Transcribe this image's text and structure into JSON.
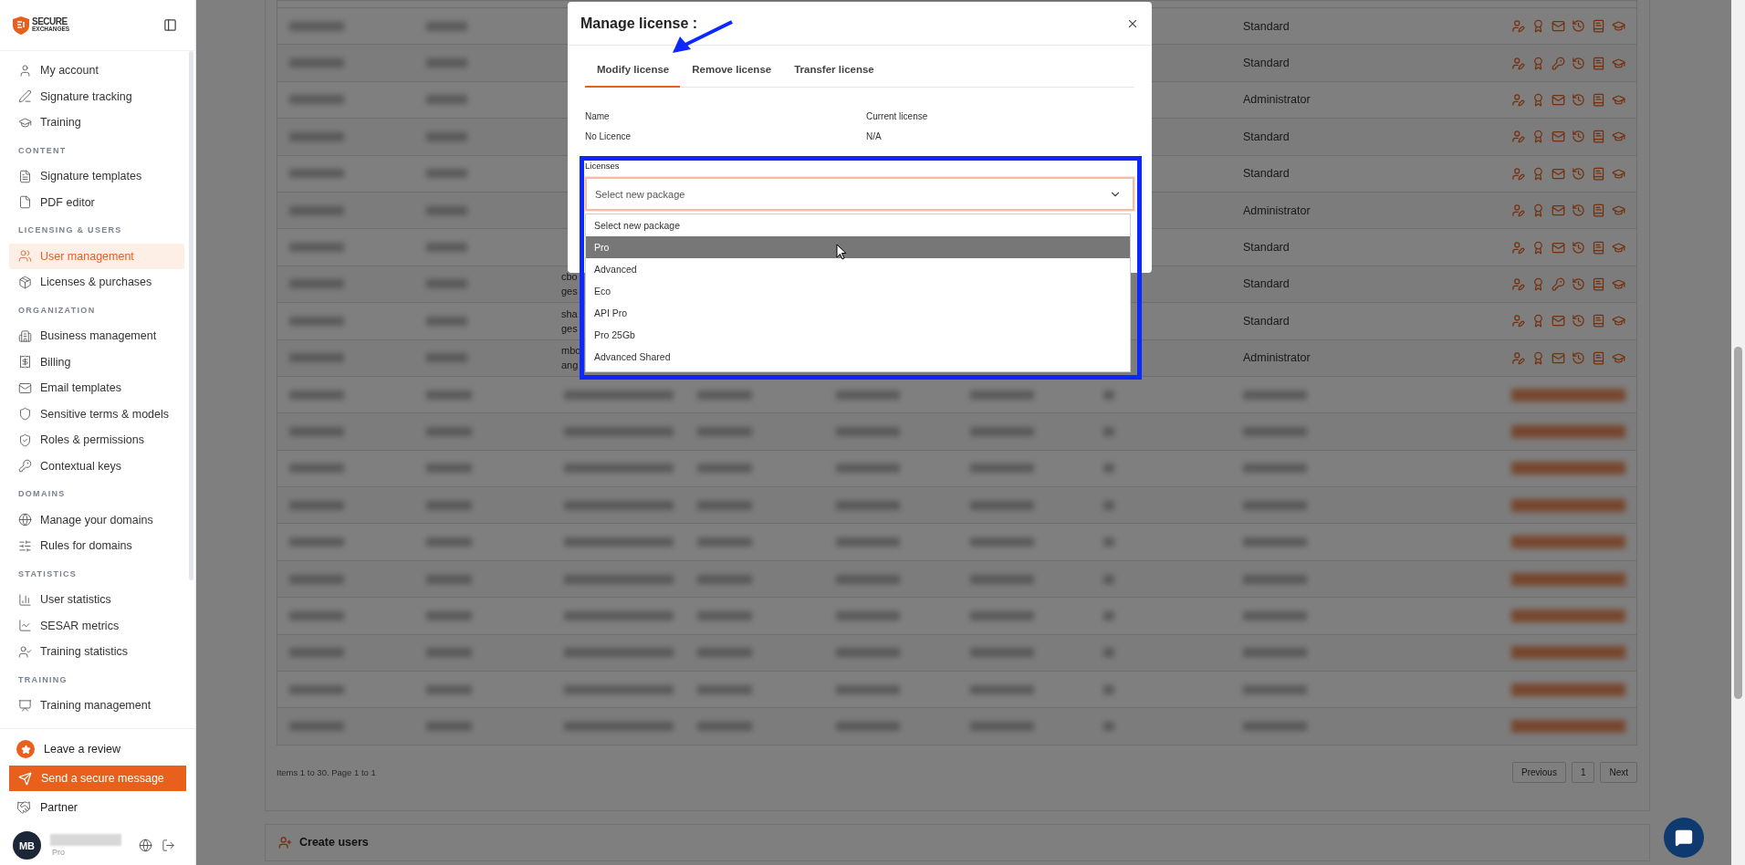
{
  "sidebar": {
    "logo_text": "SECURE",
    "logo_subtext": "EXCHANGES",
    "sections": [
      {
        "items": [
          {
            "label": "My account",
            "selected": false
          },
          {
            "label": "Signature tracking",
            "selected": false
          },
          {
            "label": "Training",
            "selected": false
          }
        ]
      },
      {
        "title": "CONTENT",
        "items": [
          {
            "label": "Signature templates",
            "selected": false
          },
          {
            "label": "PDF editor",
            "selected": false
          }
        ]
      },
      {
        "title": "LICENSING & USERS",
        "items": [
          {
            "label": "User management",
            "selected": true
          },
          {
            "label": "Licenses & purchases",
            "selected": false
          }
        ]
      },
      {
        "title": "ORGANIZATION",
        "items": [
          {
            "label": "Business management",
            "selected": false
          },
          {
            "label": "Billing",
            "selected": false
          },
          {
            "label": "Email templates",
            "selected": false
          },
          {
            "label": "Sensitive terms & models",
            "selected": false
          },
          {
            "label": "Roles & permissions",
            "selected": false
          },
          {
            "label": "Contextual keys",
            "selected": false
          }
        ]
      },
      {
        "title": "DOMAINS",
        "items": [
          {
            "label": "Manage your domains",
            "selected": false
          },
          {
            "label": "Rules for domains",
            "selected": false
          }
        ]
      },
      {
        "title": "STATISTICS",
        "items": [
          {
            "label": "User statistics",
            "selected": false
          },
          {
            "label": "SESAR metrics",
            "selected": false
          },
          {
            "label": "Training statistics",
            "selected": false
          }
        ]
      },
      {
        "title": "TRAINING",
        "items": [
          {
            "label": "Training management",
            "selected": false
          }
        ]
      }
    ],
    "review": "Leave a review",
    "send_button": "Send a secure message",
    "partner": "Partner",
    "user": {
      "initials": "MB",
      "plan": "Pro"
    }
  },
  "table": {
    "rows": [
      {
        "kind": "visible",
        "role": "Standard",
        "has_key": false
      },
      {
        "kind": "visible",
        "role": "Standard",
        "has_key": true
      },
      {
        "kind": "visible",
        "role": "Administrator",
        "has_key": false
      },
      {
        "kind": "visible",
        "role": "Standard",
        "has_key": false
      },
      {
        "kind": "visible",
        "role": "Standard",
        "has_key": false
      },
      {
        "kind": "visible",
        "role": "Administrator",
        "has_key": false
      },
      {
        "kind": "visible",
        "role": "Standard",
        "has_key": false
      },
      {
        "kind": "visible",
        "email": [
          "cbo",
          "ges"
        ],
        "role": "Standard",
        "has_key": true
      },
      {
        "kind": "visible",
        "email": [
          "sha",
          "ges"
        ],
        "role": "Standard",
        "has_key": false
      },
      {
        "kind": "visible",
        "email": [
          "mbo",
          "ang"
        ],
        "role": "Administrator",
        "has_key": false
      },
      {
        "kind": "blurred"
      },
      {
        "kind": "blurred"
      },
      {
        "kind": "blurred"
      },
      {
        "kind": "blurred"
      },
      {
        "kind": "blurred"
      },
      {
        "kind": "blurred"
      },
      {
        "kind": "blurred"
      },
      {
        "kind": "blurred"
      },
      {
        "kind": "blurred"
      },
      {
        "kind": "blurred"
      }
    ]
  },
  "pagination": {
    "summary": "Items 1 to 30. Page 1 to 1",
    "buttons": [
      "Previous",
      "1",
      "Next"
    ]
  },
  "create_users": {
    "title": "Create users"
  },
  "modal": {
    "title": "Manage license :",
    "tabs": [
      {
        "label": "Modify license",
        "selected": true
      },
      {
        "label": "Remove license",
        "selected": false
      },
      {
        "label": "Transfer license",
        "selected": false
      }
    ],
    "fields": [
      {
        "label": "Name",
        "value": "No Licence"
      },
      {
        "label": "Current license",
        "value": "N/A"
      }
    ],
    "licenses": {
      "label": "Licenses",
      "value": "Select new package",
      "expanded": true,
      "options": [
        {
          "label": "Select new package",
          "highlighted": false
        },
        {
          "label": "Pro",
          "highlighted": true
        },
        {
          "label": "Advanced",
          "highlighted": false
        },
        {
          "label": "Eco",
          "highlighted": false
        },
        {
          "label": "API Pro",
          "highlighted": false
        },
        {
          "label": "Pro 25Gb",
          "highlighted": false
        },
        {
          "label": "Advanced Shared",
          "highlighted": false
        }
      ]
    }
  }
}
